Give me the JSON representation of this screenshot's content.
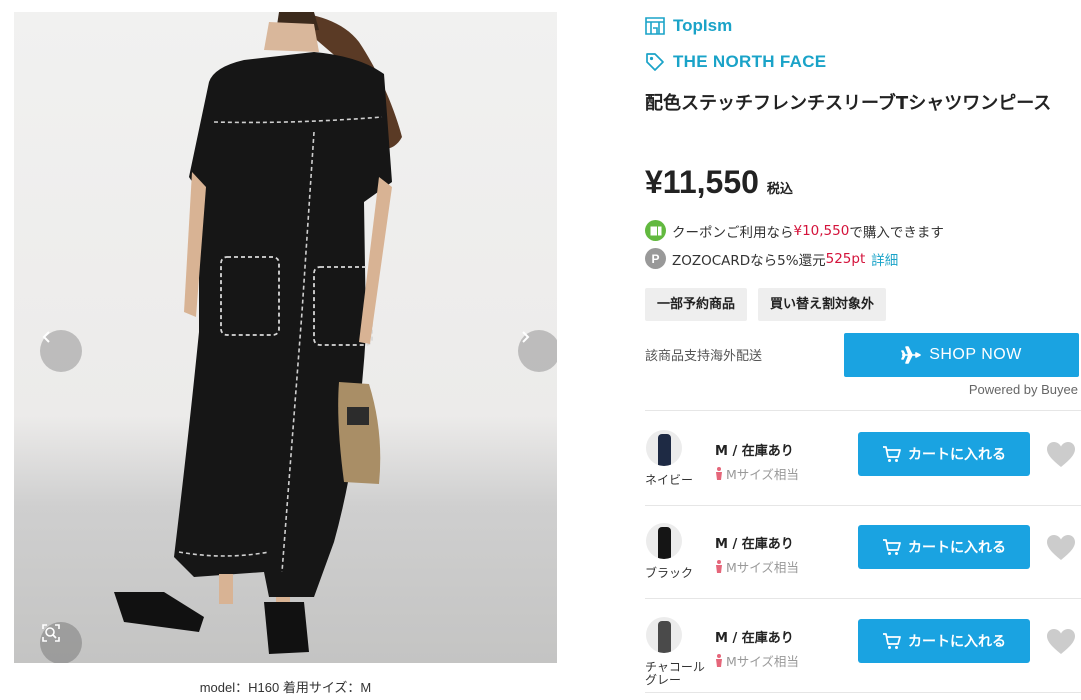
{
  "photo": {
    "caption": "model：H160 着用サイズ：M"
  },
  "shop": {
    "name": "TopIsm",
    "icon": "shop-icon"
  },
  "brand": {
    "name": "THE NORTH FACE",
    "icon": "tag-icon"
  },
  "product": {
    "title": "配色ステッチフレンチスリーブTシャツワンピース",
    "price": "¥11,550",
    "tax_label": "税込"
  },
  "coupon": {
    "prefix": "クーポンご利用なら",
    "price": "¥10,550",
    "suffix": "で購入できます"
  },
  "zozo": {
    "prefix": "ZOZOCARDなら5%還元",
    "points": "525pt",
    "link": "詳細"
  },
  "tags": [
    "一部予約商品",
    "買い替え割対象外"
  ],
  "overseas": {
    "note": "該商品支持海外配送",
    "button_label": "SHOP NOW",
    "powered_by": "Powered by Buyee"
  },
  "variants": [
    {
      "color": "ネイビー",
      "stock": "M / 在庫あり",
      "size_hint": "Mサイズ相当",
      "cart_label": "カートに入れる",
      "swatch": "#1e2a44"
    },
    {
      "color": "ブラック",
      "stock": "M / 在庫あり",
      "size_hint": "Mサイズ相当",
      "cart_label": "カートに入れる",
      "swatch": "#151515"
    },
    {
      "color": "チャコールグレー",
      "stock": "M / 在庫あり",
      "size_hint": "Mサイズ相当",
      "cart_label": "カートに入れる",
      "swatch": "#4a4a4a"
    }
  ],
  "colors": {
    "accent": "#1aa3c8",
    "button": "#1aa3e1",
    "price_red": "#d4133b",
    "coupon_green": "#62b93f"
  }
}
